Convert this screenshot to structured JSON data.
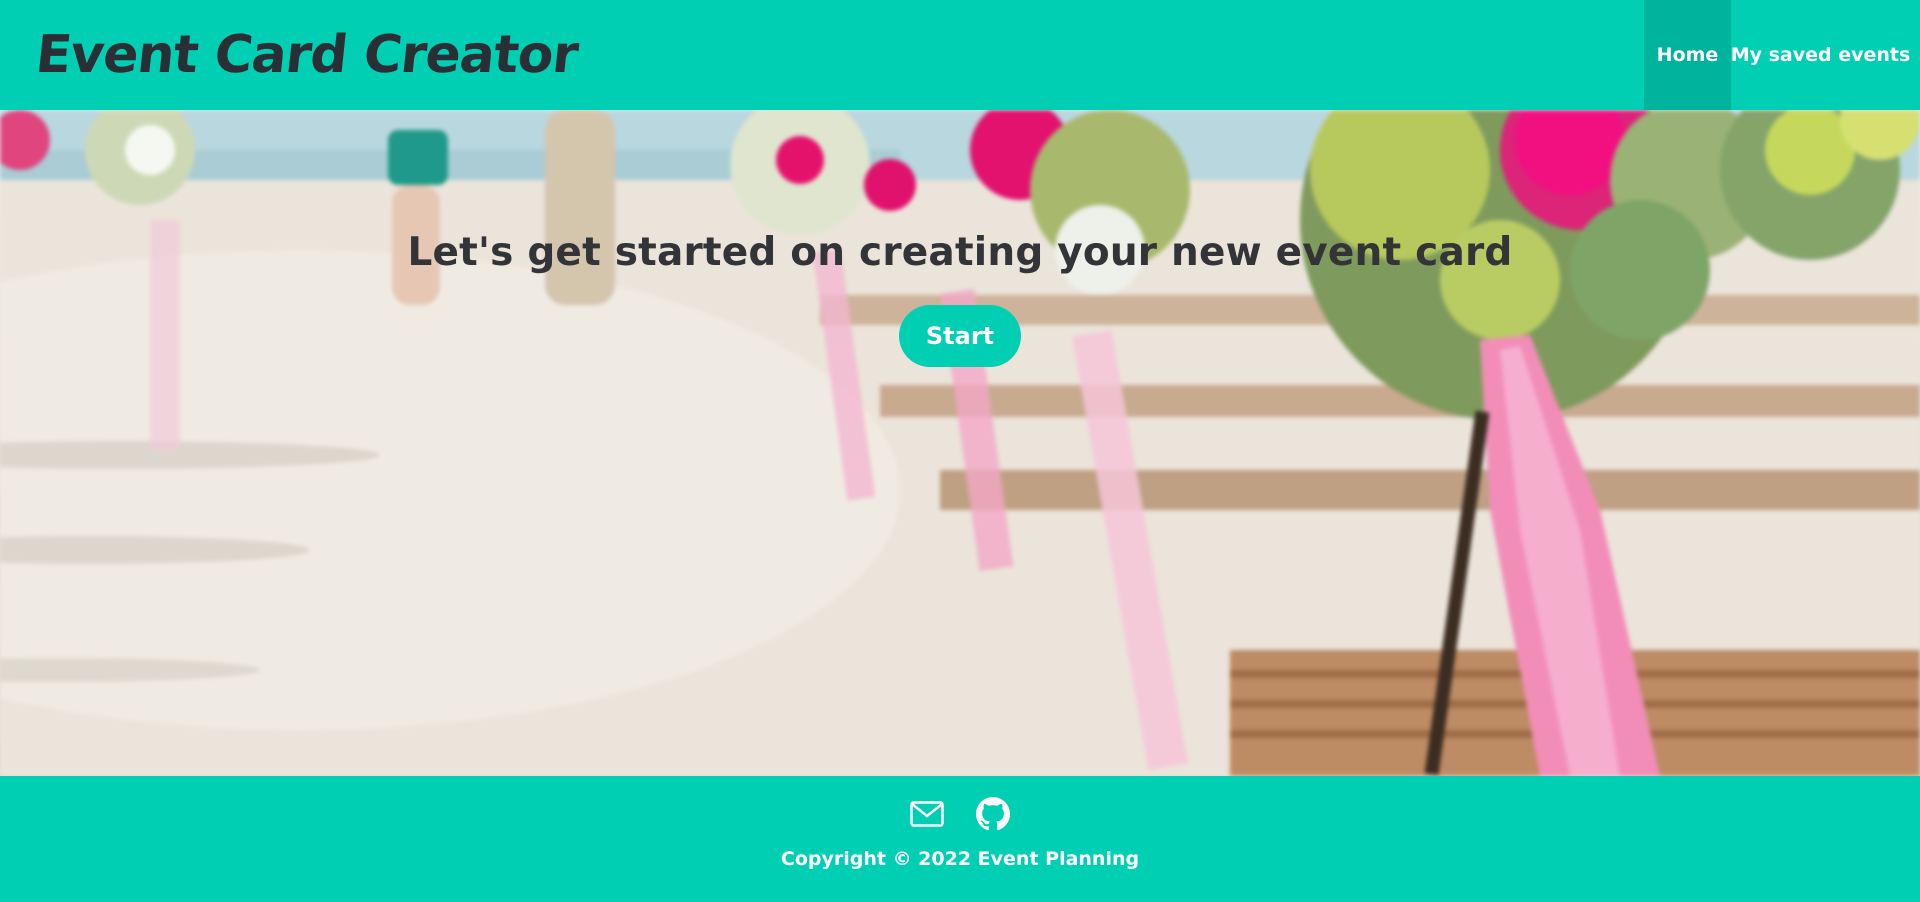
{
  "header": {
    "brand": "Event Card Creator",
    "nav": [
      {
        "label": "Home",
        "active": true
      },
      {
        "label": "My saved events",
        "active": false
      }
    ]
  },
  "hero": {
    "title": "Let's get started on creating your new event card",
    "start_label": "Start",
    "background": "wedding-aisle-photo"
  },
  "footer": {
    "icons": [
      "mail-icon",
      "github-icon"
    ],
    "copyright": "Copyright © 2022 Event Planning"
  },
  "colors": {
    "accent": "#00cfb4",
    "accent_active": "#00b39c",
    "text_dark": "#333437",
    "white": "#ffffff"
  }
}
